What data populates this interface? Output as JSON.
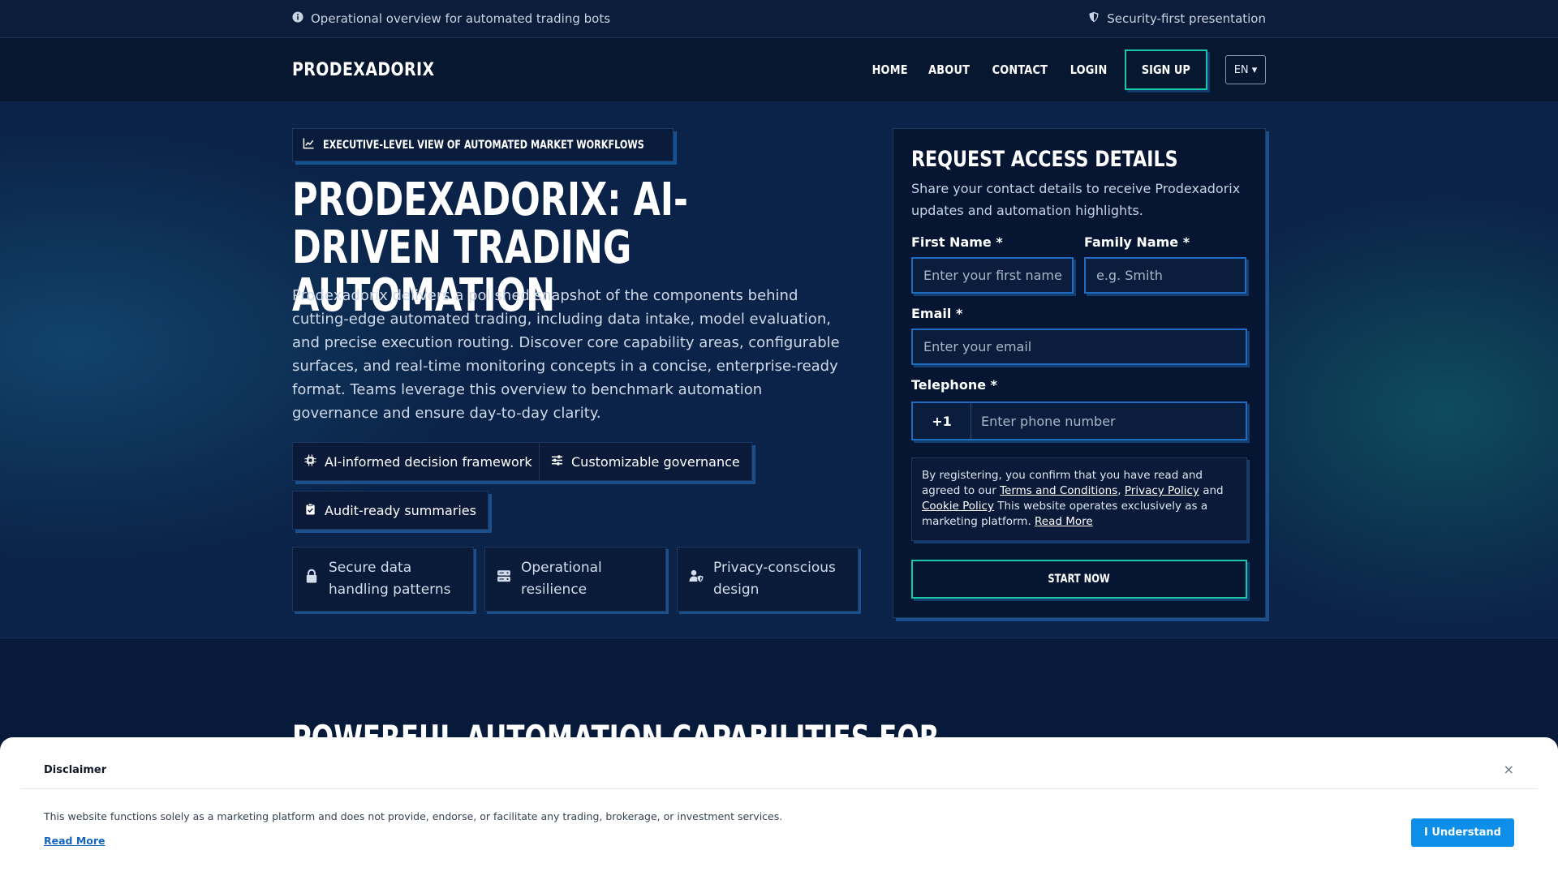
{
  "topbar": {
    "left_text": "Operational overview for automated trading bots",
    "right_text": "Security-first presentation",
    "left_icon": "info-icon",
    "right_icon": "shield-icon"
  },
  "nav": {
    "logo": "PRODEXADORIX",
    "links": [
      "HOME",
      "ABOUT",
      "CONTACT",
      "LOGIN"
    ],
    "signup": "SIGN UP",
    "language": "EN ▾"
  },
  "hero": {
    "kicker": "EXECUTIVE-LEVEL VIEW OF AUTOMATED MARKET WORKFLOWS",
    "kicker_icon": "chart-line-icon",
    "title": "PRODEXADORIX: AI-DRIVEN TRADING AUTOMATION",
    "lead": "Prodexadorix delivers a polished snapshot of the components behind cutting-edge automated trading, including data intake, model evaluation, and precise execution routing. Discover core capability areas, configurable surfaces, and real-time monitoring concepts in a concise, enterprise-ready format. Teams leverage this overview to benchmark automation governance and ensure day-to-day clarity.",
    "chips": [
      {
        "label": "AI-informed decision framework",
        "icon": "chip-icon"
      },
      {
        "label": "Customizable governance",
        "icon": "sliders-icon"
      },
      {
        "label": "Audit-ready summaries",
        "icon": "clipboard-check-icon"
      }
    ],
    "features": [
      {
        "label": "Secure data handling patterns",
        "icon": "lock-icon"
      },
      {
        "label": "Operational resilience",
        "icon": "server-icon"
      },
      {
        "label": "Privacy-conscious design",
        "icon": "user-shield-icon"
      }
    ]
  },
  "form": {
    "title": "REQUEST ACCESS DETAILS",
    "subtitle": "Share your contact details to receive Prodexadorix updates and automation highlights.",
    "first_name_label": "First Name *",
    "first_name_placeholder": "Enter your first name",
    "family_name_label": "Family Name *",
    "family_name_placeholder": "e.g. Smith",
    "email_label": "Email *",
    "email_placeholder": "Enter your email",
    "phone_label": "Telephone *",
    "phone_code": "+1",
    "phone_placeholder": "Enter phone number",
    "consent_prefix": "By registering, you confirm that you have read and agreed to our",
    "terms": "Terms and Conditions",
    "privacy": "Privacy Policy",
    "and": "and",
    "cookie": "Cookie Policy",
    "consent_suffix": "This website operates exclusively as a marketing platform.",
    "read_more": "Read More",
    "submit": "START NOW"
  },
  "section2": {
    "title": "POWERFUL AUTOMATION CAPABILITIES FOR"
  },
  "disclaimer": {
    "title": "Disclaimer",
    "text": "This website functions solely as a marketing platform and does not provide, endorse, or facilitate any trading, brokerage, or investment services.",
    "read_more": "Read More",
    "button": "I Understand",
    "close": "×"
  },
  "colors": {
    "accent": "#19c7a8",
    "input_border": "#1e6bc0",
    "background": "#0b2348",
    "button_blue": "#0d8ee9"
  }
}
